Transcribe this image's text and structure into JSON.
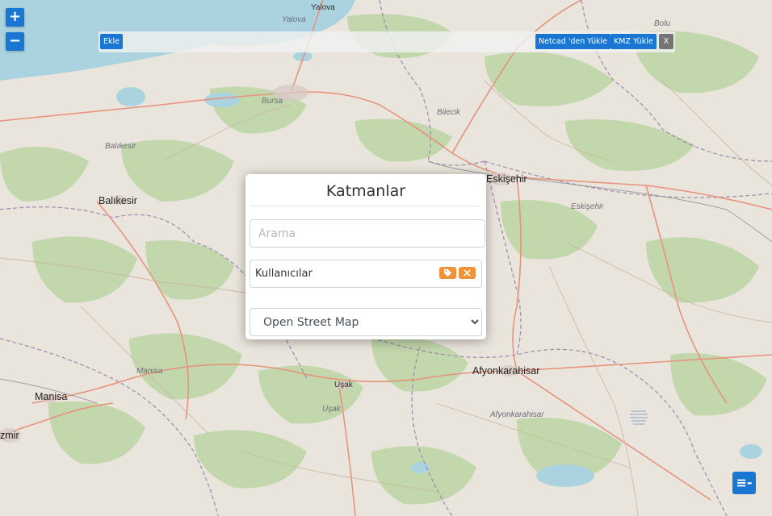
{
  "map": {
    "zoom_in_label": "+",
    "zoom_out_label": "−",
    "labels": {
      "yalova_town": "Yalova",
      "yalova_district": "Yalova",
      "bolu": "Bolu",
      "bursa": "Bursa",
      "bilecik": "Bilecik",
      "balikesir_district": "Balıkesir",
      "balikesir_city": "Balıkesir",
      "eskisehir_city": "Eskişehir",
      "eskisehir_district": "Eskişehir",
      "manisa_district": "Manisa",
      "manisa_city": "Manisa",
      "izmir": "zmir",
      "usak_town": "Uşak",
      "usak_district": "Uşak",
      "afyon_city": "Afyonkarahisar",
      "afyon_district": "Afyonkarahisar"
    }
  },
  "toolbar": {
    "add_label": "Ekle",
    "netcad_label": "Netcad 'den Yükle",
    "kmz_label": "KMZ Yükle",
    "close_label": "X"
  },
  "panel": {
    "title": "Katmanlar",
    "search_placeholder": "Arama",
    "layers": [
      {
        "label": "Kullanıcılar"
      }
    ],
    "basemap_selected": "Open Street Map"
  },
  "menu": {
    "icon": "menu-collapse-icon",
    "glyph": "≡-"
  },
  "colors": {
    "accent": "#1976d2",
    "layer_action": "#f0923a",
    "close_button": "#757575"
  }
}
